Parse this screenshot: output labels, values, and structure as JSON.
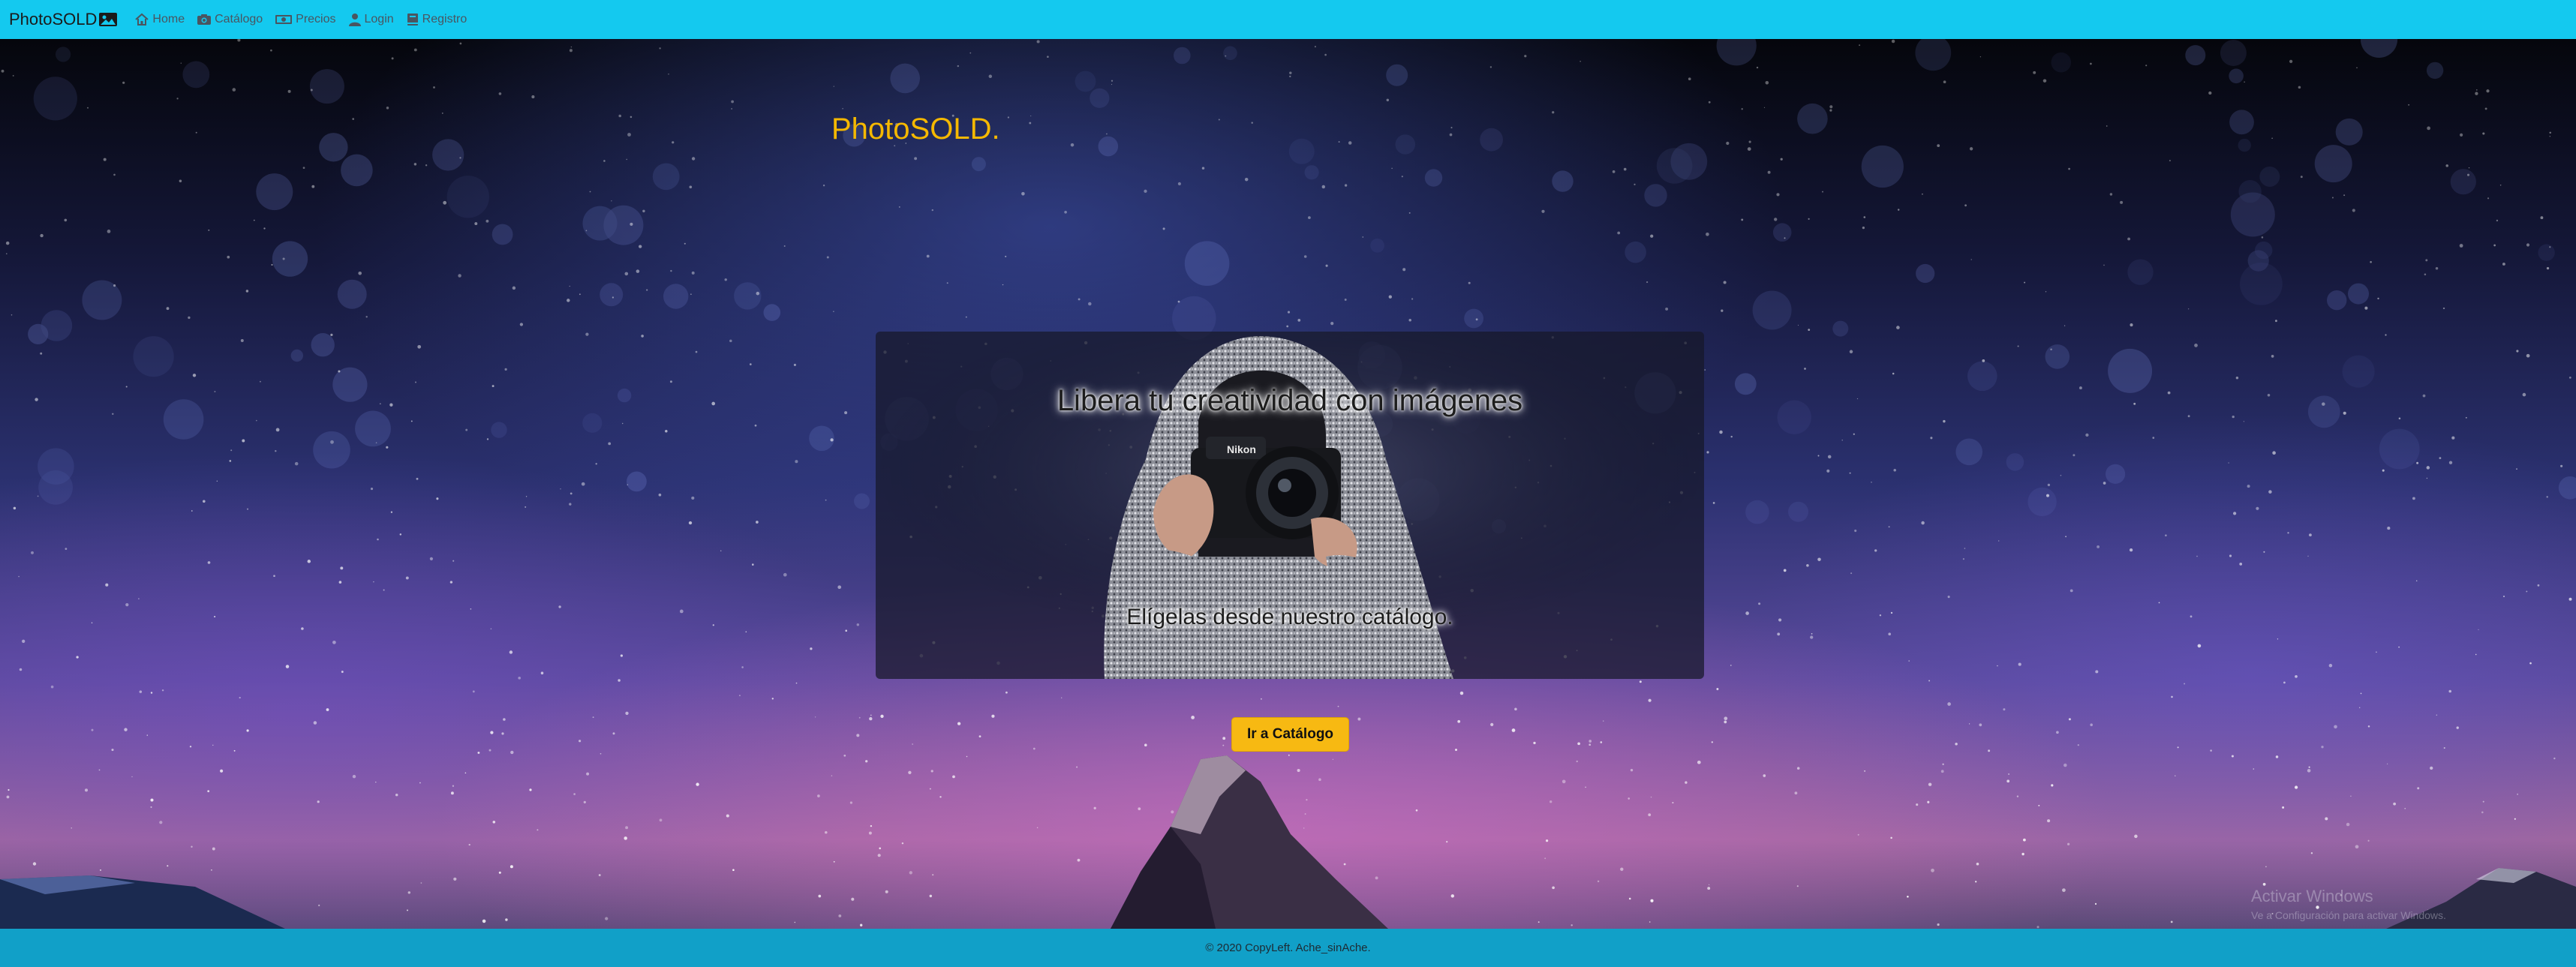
{
  "nav": {
    "brand": "PhotoSOLD",
    "brand_icon": "image-icon",
    "items": [
      {
        "label": "Home",
        "icon": "home-icon"
      },
      {
        "label": "Catálogo",
        "icon": "camera-icon"
      },
      {
        "label": "Precios",
        "icon": "money-icon"
      },
      {
        "label": "Login",
        "icon": "user-icon"
      },
      {
        "label": "Registro",
        "icon": "book-icon"
      }
    ]
  },
  "hero": {
    "title": "PhotoSOLD.",
    "card": {
      "headline": "Libera tu creatividad con imágenes",
      "subline": "Elígelas desde nuestro catálogo."
    },
    "cta_label": "Ir a Catálogo"
  },
  "watermark": {
    "line1": "Activar Windows",
    "line2": "Ve a Configuración para activar Windows."
  },
  "footer": {
    "text": "© 2020 CopyLeft. Ache_sinAche."
  },
  "colors": {
    "navbar": "#14c9ef",
    "footer": "#11a0c8",
    "title": "#f5b800",
    "button": "#f7b912"
  }
}
